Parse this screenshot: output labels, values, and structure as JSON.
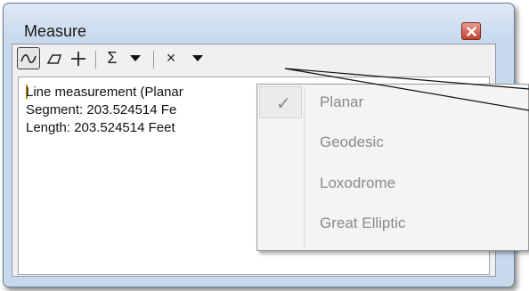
{
  "window": {
    "title": "Measure"
  },
  "toolbar": {
    "sigma_label": "Σ",
    "clear_label": "×"
  },
  "results": {
    "lines": [
      "Line measurement (Planar",
      "Segment: 203.524514 Fe",
      "Length: 203.524514 Feet"
    ]
  },
  "menu": {
    "items": [
      {
        "label": "Planar",
        "checked": true
      },
      {
        "label": "Geodesic",
        "checked": false
      },
      {
        "label": "Loxodrome",
        "checked": false
      },
      {
        "label": "Great Elliptic",
        "checked": false
      }
    ]
  },
  "colors": {
    "title_bar": "#c7d8ec",
    "close_button": "#c2412f",
    "menu_text_disabled": "#8a8a8a"
  },
  "icons": [
    "line-measure-icon",
    "area-measure-icon",
    "feature-measure-icon",
    "sum-icon",
    "dropdown-arrow-icon",
    "clear-icon",
    "units-dropdown-arrow-icon",
    "close-icon",
    "checkmark-icon"
  ]
}
